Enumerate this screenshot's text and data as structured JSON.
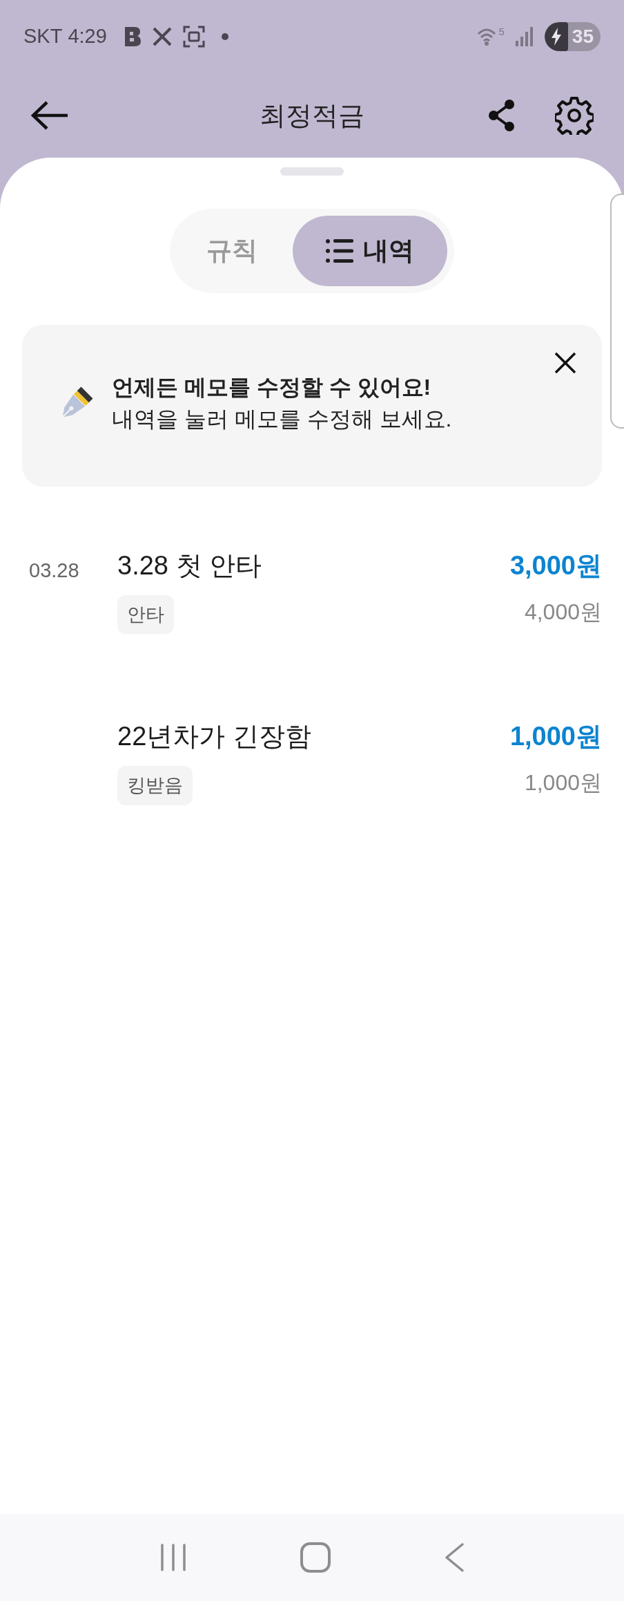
{
  "status_bar": {
    "carrier": "SKT",
    "time": "4:29",
    "network": "5",
    "battery": "35",
    "charging": true
  },
  "header": {
    "title": "최정적금"
  },
  "tabs": [
    {
      "label": "규칙",
      "selected": false
    },
    {
      "label": "내역",
      "selected": true
    }
  ],
  "notice": {
    "title": "언제든 메모를 수정할 수 있어요!",
    "text": "내역을 눌러 메모를 수정해 보세요."
  },
  "entries": [
    {
      "date": "03.28",
      "title": "3.28 첫 안타",
      "tag": "안타",
      "amount": "3,000원",
      "balance": "4,000원"
    },
    {
      "title": "22년차가 긴장함",
      "tag": "킹받음",
      "amount": "1,000원",
      "balance": "1,000원"
    }
  ]
}
